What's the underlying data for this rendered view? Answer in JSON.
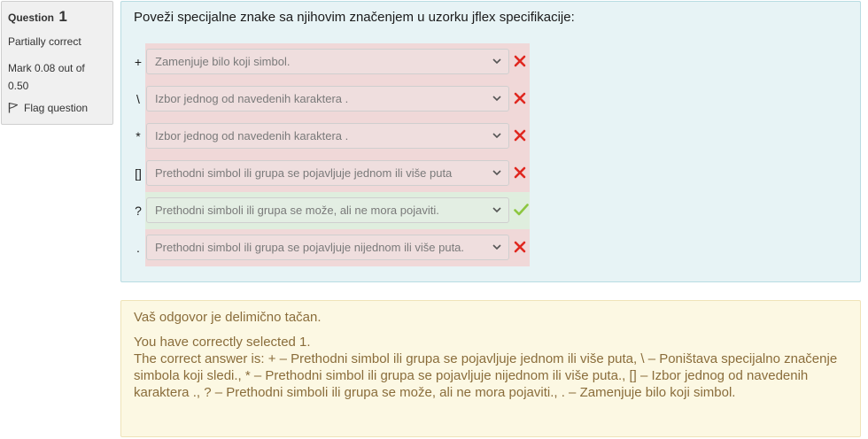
{
  "info": {
    "question_label": "Question",
    "question_number": "1",
    "state": "Partially correct",
    "grade": "Mark 0.08 out of 0.50",
    "flag_label": "Flag question",
    "flag_icon": "flag-icon"
  },
  "question": {
    "text": "Poveži specijalne znake sa njihovim značenjem u uzorku jflex specifikacije:",
    "rows": [
      {
        "symbol": "+",
        "selected": "Zamenjuje bilo koji simbol.",
        "status": "incorrect",
        "status_icon": "cross-icon"
      },
      {
        "symbol": "\\",
        "selected": "Izbor jednog od navedenih karaktera .",
        "status": "incorrect",
        "status_icon": "cross-icon"
      },
      {
        "symbol": "*",
        "selected": "Izbor jednog od navedenih karaktera .",
        "status": "incorrect",
        "status_icon": "cross-icon"
      },
      {
        "symbol": "[]",
        "selected": "Prethodni simbol ili grupa se pojavljuje jednom ili više puta",
        "status": "incorrect",
        "status_icon": "cross-icon"
      },
      {
        "symbol": "?",
        "selected": "Prethodni simboli ili grupa se može, ali ne mora pojaviti.",
        "status": "correct",
        "status_icon": "check-icon"
      },
      {
        "symbol": ".",
        "selected": "Prethodni simbol ili grupa se pojavljuje nijednom ili više puta.",
        "status": "incorrect",
        "status_icon": "cross-icon"
      }
    ]
  },
  "feedback": {
    "general": "Vaš odgovor je delimično tačan.",
    "selected_count": "You have correctly selected 1.",
    "right_answer": "The correct answer is: + – Prethodni simbol ili grupa se pojavljuje jednom ili više puta, \\ – Poništava specijalno značenje simbola koji sledi., * – Prethodni simbol ili grupa se pojavljuje nijednom ili više puta., [] – Izbor jednog od navedenih karaktera ., ? – Prethodni simboli ili grupa se može, ali ne mora pojaviti., . – Zamenjuje bilo koji simbol."
  },
  "colors": {
    "incorrect_bg": "#f0d8d8",
    "correct_bg": "#dfeede",
    "cross": "#e0271f",
    "check": "#8cc63f",
    "panel_bg": "#e7f3f5",
    "feedback_bg": "#fcf8e3",
    "feedback_text": "#8a6d3b"
  }
}
